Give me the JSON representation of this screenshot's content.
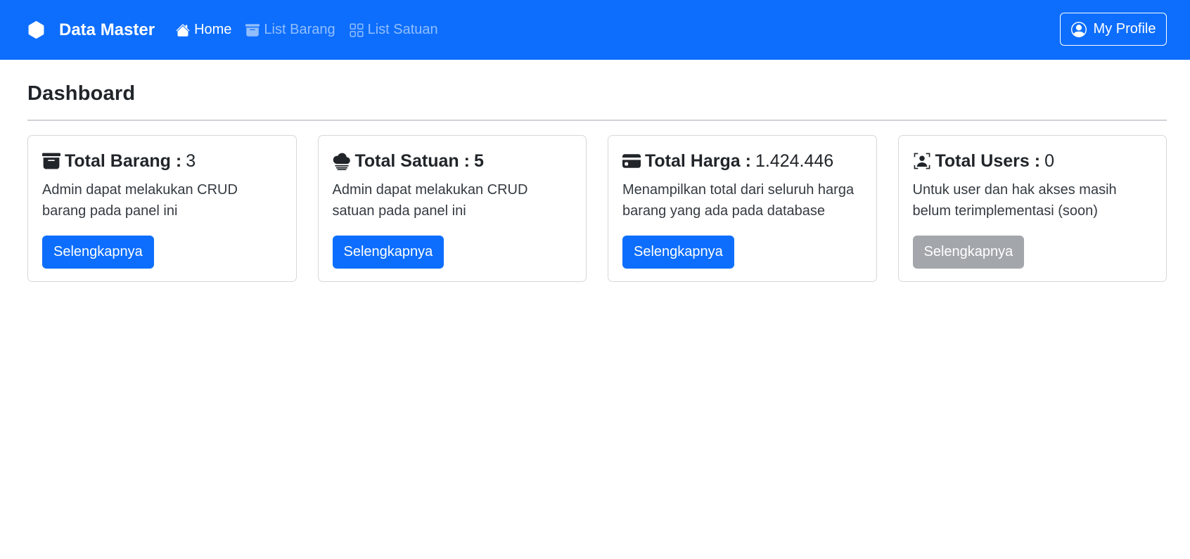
{
  "navbar": {
    "brand": "Data Master",
    "links": [
      {
        "label": "Home",
        "icon": "house-icon",
        "active": true
      },
      {
        "label": "List Barang",
        "icon": "archive-icon",
        "active": false
      },
      {
        "label": "List Satuan",
        "icon": "grid-icon",
        "active": false
      }
    ],
    "profile_label": "My Profile",
    "color": "#0d6efd"
  },
  "page": {
    "title": "Dashboard"
  },
  "cards": [
    {
      "icon": "archive-icon",
      "label": "Total Barang :",
      "value": "3",
      "text": "Admin dapat melakukan CRUD barang pada panel ini",
      "button": "Selengkapnya",
      "button_disabled": false
    },
    {
      "icon": "cloud-haze-icon",
      "label": "Total Satuan :",
      "value": "5",
      "text": "Admin dapat melakukan CRUD satuan pada panel ini",
      "button": "Selengkapnya",
      "button_disabled": false
    },
    {
      "icon": "credit-card-icon",
      "label": "Total Harga :",
      "value": "1.424.446",
      "text": "Menampilkan total dari seluruh harga barang yang ada pada database",
      "button": "Selengkapnya",
      "button_disabled": false
    },
    {
      "icon": "person-badge-icon",
      "label": "Total Users :",
      "value": "0",
      "text": "Untuk user dan hak akses masih belum terimplementasi (soon)",
      "button": "Selengkapnya",
      "button_disabled": true
    }
  ],
  "colors": {
    "primary": "#0d6efd",
    "disabled": "#a3a7ab"
  }
}
